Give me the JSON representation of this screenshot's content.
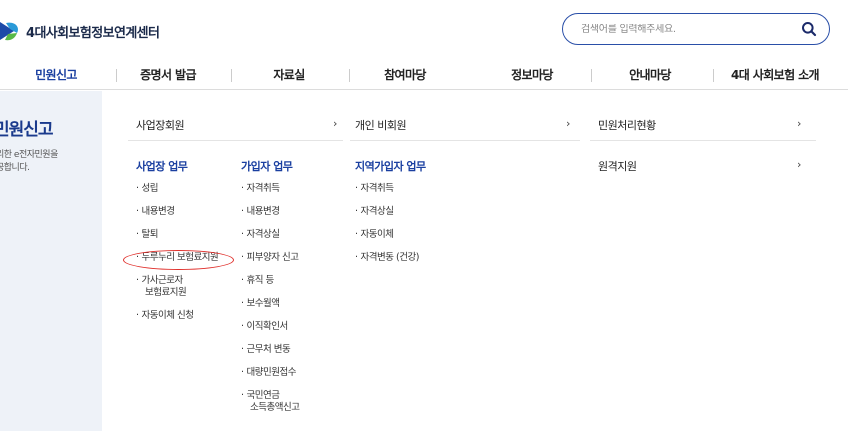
{
  "header": {
    "logo_text": "4대사회보험정보연계센터",
    "search_placeholder": "검색어를 입력해주세요."
  },
  "nav": [
    "민원신고",
    "증명서 발급",
    "자료실",
    "참여마당",
    "정보마당",
    "안내마당",
    "4대 사회보험 소개"
  ],
  "side": {
    "title": "민원신고",
    "desc_line1": "리한 e전자민원을",
    "desc_line2": "공합니다."
  },
  "menu": {
    "top": {
      "business": "사업장회원",
      "personal": "개인 비회원",
      "status": "민원처리현황",
      "remote": "원격지원"
    },
    "chevron": "›",
    "biz_header": "사업장 업무",
    "biz_items": [
      "성립",
      "내용변경",
      "탈퇴",
      "두루누리 보험료지원",
      "가사근로자",
      "보험료지원",
      "자동이체 신청"
    ],
    "sub_header": "가입자 업무",
    "sub_items": [
      "자격취득",
      "내용변경",
      "자격상실",
      "피부양자 신고",
      "휴직 등",
      "보수월액",
      "이직확인서",
      "근무처 변동",
      "대량민원접수",
      "국민연금",
      "소득총액신고"
    ],
    "region_header": "지역가입자 업무",
    "region_items": [
      "자격취득",
      "자격상실",
      "자동이체",
      "자격변동 (건강)"
    ],
    "bullet": "·"
  }
}
